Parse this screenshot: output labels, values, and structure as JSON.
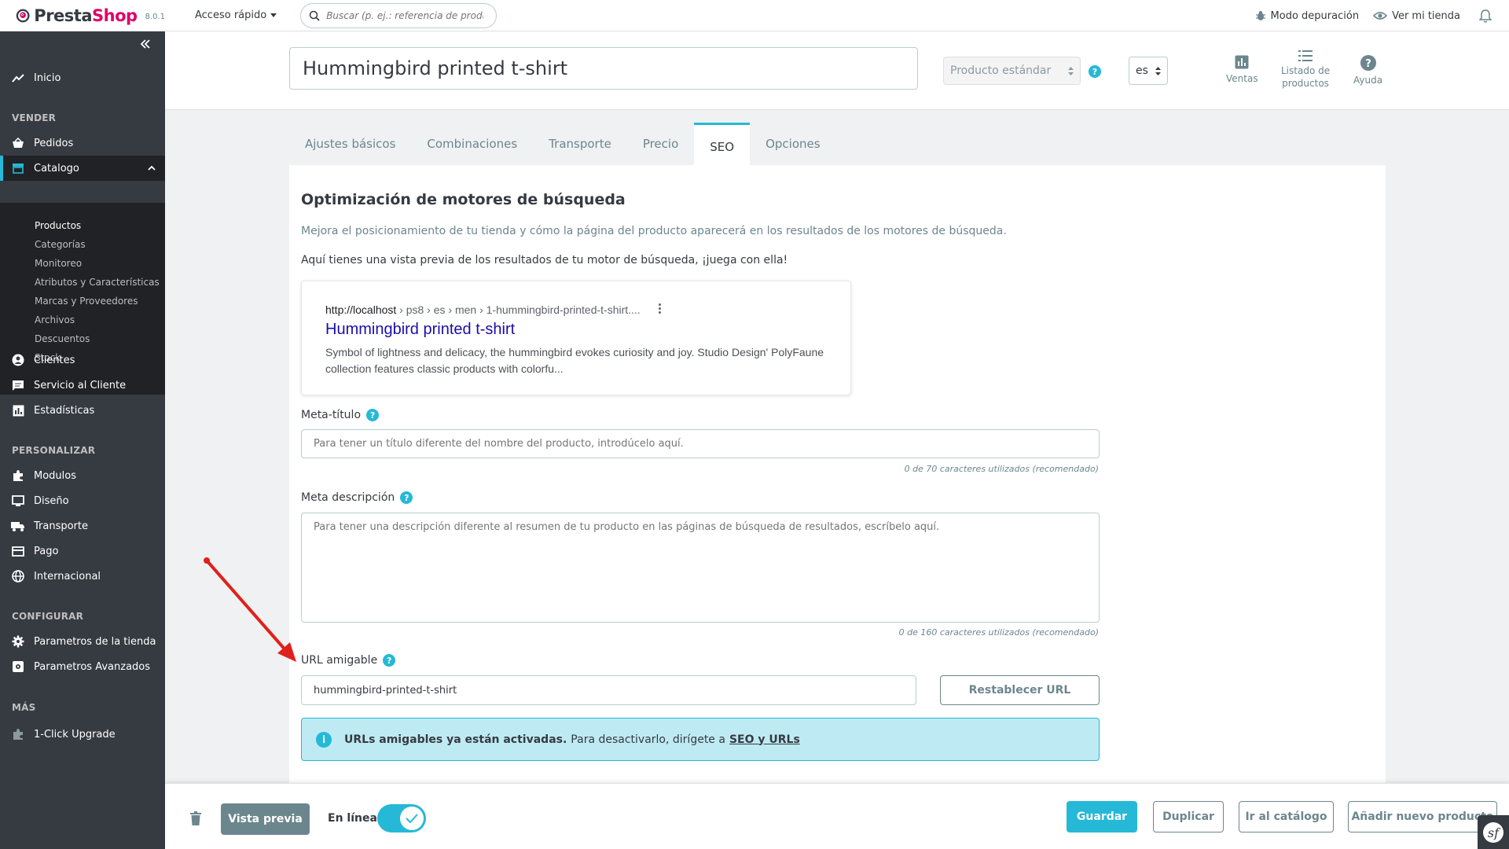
{
  "header": {
    "logo_text_a": "Presta",
    "logo_text_b": "Shop",
    "version": "8.0.1",
    "quick_access": "Acceso rápido",
    "search_placeholder": "Buscar (p. ej.: referencia de producto,",
    "debug_mode": "Modo depuración",
    "view_store": "Ver mi tienda"
  },
  "sidebar": {
    "home": "Inicio",
    "sections": {
      "sell": "VENDER",
      "customize": "PERSONALIZAR",
      "configure": "CONFIGURAR",
      "more": "MÁS"
    },
    "orders": "Pedidos",
    "catalog": "Catalogo",
    "catalog_sub": [
      "Productos",
      "Categorías",
      "Monitoreo",
      "Atributos y Características",
      "Marcas y Proveedores",
      "Archivos",
      "Descuentos",
      "Stock"
    ],
    "customers": "Clientes",
    "customer_service": "Servicio al Cliente",
    "stats": "Estadísticas",
    "modules": "Modulos",
    "design": "Diseño",
    "shipping": "Transporte",
    "payment": "Pago",
    "international": "Internacional",
    "shop_params": "Parametros de la tienda",
    "advanced_params": "Parametros Avanzados",
    "upgrade": "1-Click Upgrade"
  },
  "product_header": {
    "name": "Hummingbird printed t-shirt",
    "type": "Producto estándar",
    "lang": "es",
    "sales": "Ventas",
    "product_list_1": "Listado de",
    "product_list_2": "productos",
    "help": "Ayuda"
  },
  "tabs": [
    "Ajustes básicos",
    "Combinaciones",
    "Transporte",
    "Precio",
    "SEO",
    "Opciones"
  ],
  "seo": {
    "title": "Optimización de motores de búsqueda",
    "description": "Mejora el posicionamiento de tu tienda y cómo la página del producto aparecerá en los resultados de los motores de búsqueda.",
    "preview_intro": "Aquí tienes una vista previa de los resultados de tu motor de búsqueda, ¡juega con ella!",
    "serp": {
      "url_host": "http://localhost",
      "url_path": " › ps8 › es › men › 1-hummingbird-printed-t-shirt....",
      "title": "Hummingbird printed t-shirt",
      "snippet": "Symbol of lightness and delicacy, the hummingbird evokes curiosity and joy. Studio Design' PolyFaune collection features classic products with colorfu..."
    },
    "meta_title_label": "Meta-título",
    "meta_title_placeholder": "Para tener un título diferente del nombre del producto, introdúcelo aquí.",
    "meta_title_counter": "0 de 70 caracteres utilizados (recomendado)",
    "meta_desc_label": "Meta descripción",
    "meta_desc_placeholder": "Para tener una descripción diferente al resumen de tu producto en las páginas de búsqueda de resultados, escríbelo aquí.",
    "meta_desc_counter": "0 de 160 caracteres utilizados (recomendado)",
    "friendly_url_label": "URL amigable",
    "friendly_url_value": "hummingbird-printed-t-shirt",
    "reset_url": "Restablecer URL",
    "alert_bold": "URLs amigables ya están activadas.",
    "alert_text": "Para desactivarlo, dirígete a",
    "alert_link": "SEO y URLs"
  },
  "footer": {
    "preview": "Vista previa",
    "online": "En línea",
    "save": "Guardar",
    "duplicate": "Duplicar",
    "go_catalog": "Ir al catálogo",
    "add_new": "Añadir nuevo producto",
    "sf_icon": "sf"
  },
  "colors": {
    "accent": "#25b9d7",
    "sidebar": "#363a41",
    "brand_pink": "#df0067",
    "annotation_arrow": "#e0201b"
  }
}
